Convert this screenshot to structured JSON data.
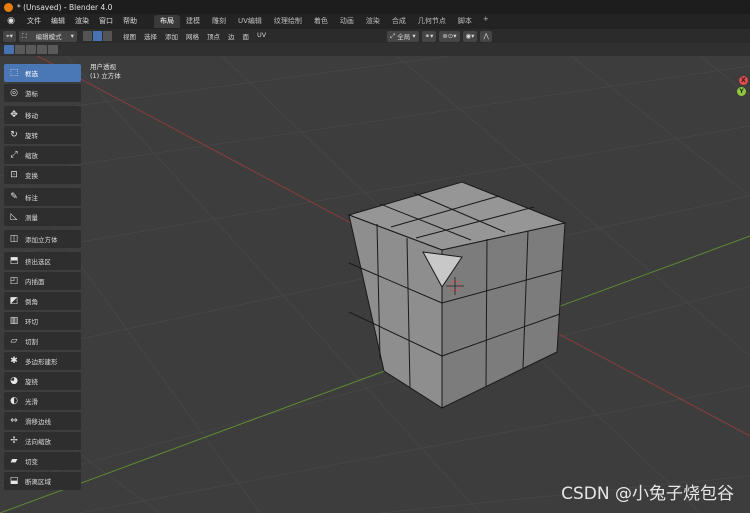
{
  "window": {
    "title": "* (Unsaved) - Blender 4.0"
  },
  "menubar": {
    "items": [
      "文件",
      "编辑",
      "渲染",
      "窗口",
      "帮助"
    ],
    "workspaces": [
      "布局",
      "建模",
      "雕刻",
      "UV编辑",
      "纹理绘制",
      "着色",
      "动画",
      "渲染",
      "合成",
      "几何节点",
      "脚本"
    ],
    "active_workspace": "布局",
    "add_tab": "+"
  },
  "header": {
    "mode": "编辑模式",
    "menus": [
      "视图",
      "选择",
      "添加",
      "网格",
      "顶点",
      "边",
      "面",
      "UV"
    ],
    "orientation": "全局"
  },
  "viewport": {
    "view_name": "用户透视",
    "object_name": "(1) 立方体",
    "gizmo": {
      "x": "X",
      "y": "Y"
    }
  },
  "tools": [
    {
      "label": "框选",
      "icon": "select-box-icon",
      "glyph": "⬚"
    },
    {
      "label": "游标",
      "icon": "cursor-icon",
      "glyph": "◎"
    },
    {
      "label": "移动",
      "icon": "move-icon",
      "glyph": "✥"
    },
    {
      "label": "旋转",
      "icon": "rotate-icon",
      "glyph": "↻"
    },
    {
      "label": "缩放",
      "icon": "scale-icon",
      "glyph": "⤢"
    },
    {
      "label": "变换",
      "icon": "transform-icon",
      "glyph": "⊡"
    },
    {
      "label": "标注",
      "icon": "annotate-icon",
      "glyph": "✎"
    },
    {
      "label": "测量",
      "icon": "measure-icon",
      "glyph": "◺"
    },
    {
      "label": "添加立方体",
      "icon": "add-cube-icon",
      "glyph": "◫"
    },
    {
      "label": "挤出选区",
      "icon": "extrude-icon",
      "glyph": "⬒"
    },
    {
      "label": "内插面",
      "icon": "inset-icon",
      "glyph": "◰"
    },
    {
      "label": "倒角",
      "icon": "bevel-icon",
      "glyph": "◩"
    },
    {
      "label": "环切",
      "icon": "loop-cut-icon",
      "glyph": "▥"
    },
    {
      "label": "切割",
      "icon": "knife-icon",
      "glyph": "▱"
    },
    {
      "label": "多边形建形",
      "icon": "poly-build-icon",
      "glyph": "✱"
    },
    {
      "label": "旋绕",
      "icon": "spin-icon",
      "glyph": "◕"
    },
    {
      "label": "光滑",
      "icon": "smooth-icon",
      "glyph": "◐"
    },
    {
      "label": "滑移边线",
      "icon": "edge-slide-icon",
      "glyph": "⇔"
    },
    {
      "label": "法向缩放",
      "icon": "shrink-fatten-icon",
      "glyph": "✢"
    },
    {
      "label": "切变",
      "icon": "shear-icon",
      "glyph": "▰"
    },
    {
      "label": "断离区域",
      "icon": "rip-region-icon",
      "glyph": "⬓"
    }
  ],
  "watermark": "CSDN @小兔子烧包谷",
  "colors": {
    "accent": "#4772b3",
    "x_axis": "#e34c4c",
    "y_axis": "#8fc93a",
    "blender_logo": "#e87d0d"
  }
}
